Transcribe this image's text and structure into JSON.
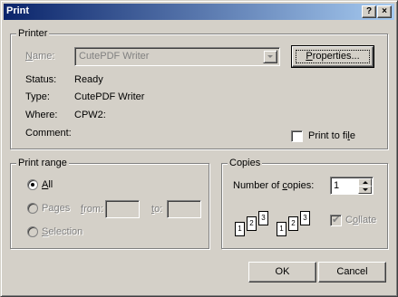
{
  "window": {
    "title": "Print",
    "help_button": "?",
    "close_button": "×"
  },
  "printer": {
    "group_label": "Printer",
    "name_label": "Name:",
    "name_value": "CutePDF Writer",
    "properties_button": "Properties...",
    "status_label": "Status:",
    "status_value": "Ready",
    "type_label": "Type:",
    "type_value": "CutePDF Writer",
    "where_label": "Where:",
    "where_value": "CPW2:",
    "comment_label": "Comment:",
    "comment_value": "",
    "print_to_file_label": "Print to file",
    "print_to_file_checked": false
  },
  "print_range": {
    "group_label": "Print range",
    "all_label": "All",
    "pages_label": "Pages",
    "from_label": "from:",
    "to_label": "to:",
    "from_value": "",
    "to_value": "",
    "selection_label": "Selection",
    "selected": "All"
  },
  "copies": {
    "group_label": "Copies",
    "number_label": "Number of copies:",
    "number_value": "1",
    "collate_label": "Collate",
    "collate_checked": true,
    "collate_pages": [
      "1",
      "2",
      "3"
    ]
  },
  "footer": {
    "ok_label": "OK",
    "cancel_label": "Cancel"
  },
  "colors": {
    "face": "#d4d0c8",
    "title_start": "#0a246a",
    "title_end": "#a6caf0",
    "disabled_text": "#808080"
  }
}
